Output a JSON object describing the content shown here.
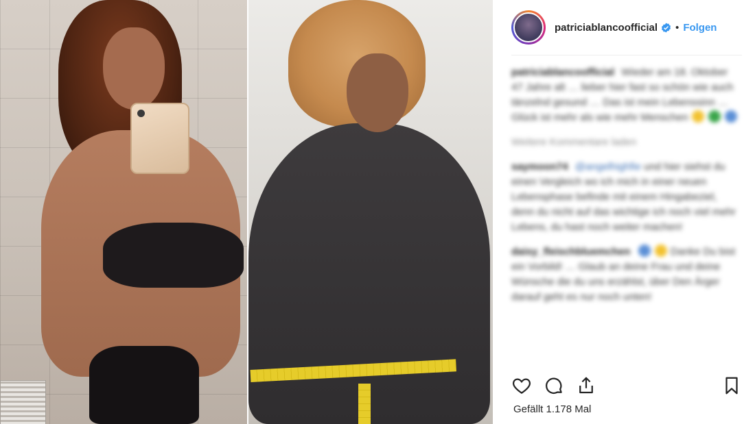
{
  "post": {
    "username": "patriciablancoofficial",
    "follow_label": "Folgen",
    "separator": "•",
    "likes_text": "Gefällt 1.178 Mal"
  },
  "comments": [
    {
      "user": "patriciablancoofficial",
      "text": "Wieder am 18. Oktober 47 Jahre alt … lieber hier fast so schön wie auch tänzelnd gesund … Das ist mein Lebenssinn … Glück ist mehr als wie mehr Menschen"
    },
    {
      "user": "",
      "text": "Weitere Kommentare laden",
      "muted": true
    },
    {
      "user": "saymoon74",
      "mention": "@angelhighfie",
      "text": "und hier siehst du einen Vergleich wo ich mich in einer neuen Lebensphase befinde mit einem Hingabeziel, denn du nicht auf das wichtige ich noch viel mehr Lebens, du hast noch weiter machen!"
    },
    {
      "user": "daisy_fleischbluemchen",
      "text": "Danke Du bist ein Vorbild! … Glaub an deine Frau und deine Wünsche die du uns erzählst, über Den Ärger darauf geht es nur noch unten!"
    }
  ],
  "icons": {
    "like": "heart-icon",
    "comment": "comment-bubble-icon",
    "share": "share-icon",
    "save": "bookmark-icon",
    "verified": "verified-badge-icon"
  },
  "colors": {
    "accent": "#3897f0",
    "text": "#262626"
  }
}
